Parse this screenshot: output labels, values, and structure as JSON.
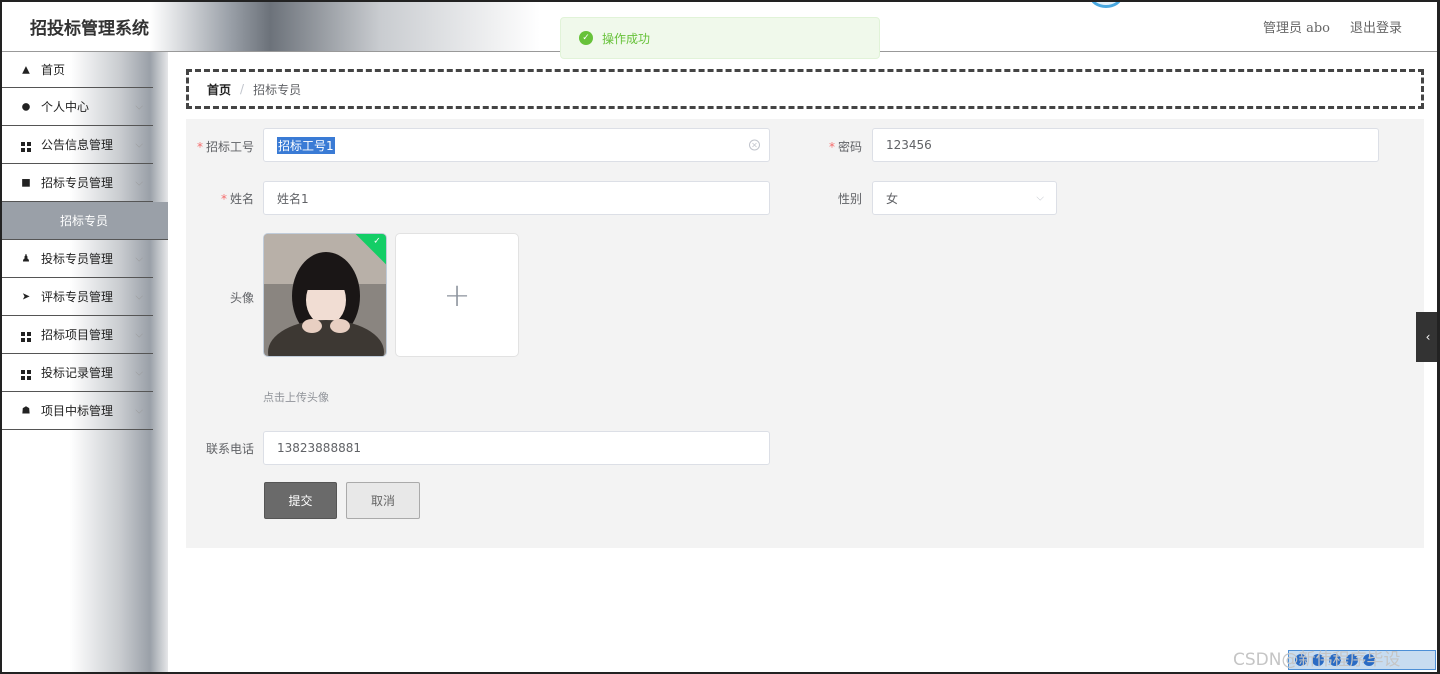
{
  "header": {
    "title": "招投标管理系统",
    "user_label": "管理员 abo",
    "logout_label": "退出登录"
  },
  "toast": {
    "message": "操作成功"
  },
  "sidebar": {
    "items": [
      {
        "label": "首页",
        "icon": "home-icon"
      },
      {
        "label": "个人中心",
        "icon": "user-icon"
      },
      {
        "label": "公告信息管理",
        "icon": "grid-icon"
      },
      {
        "label": "招标专员管理",
        "icon": "briefcase-icon"
      },
      {
        "label": "投标专员管理",
        "icon": "user-tie-icon"
      },
      {
        "label": "评标专员管理",
        "icon": "paper-plane-icon"
      },
      {
        "label": "招标项目管理",
        "icon": "grid-icon"
      },
      {
        "label": "投标记录管理",
        "icon": "grid-icon"
      },
      {
        "label": "项目中标管理",
        "icon": "thumbs-up-icon"
      }
    ],
    "active_sub": "招标专员"
  },
  "breadcrumb": {
    "home": "首页",
    "separator": "/",
    "current": "招标专员"
  },
  "form": {
    "id_label": "招标工号",
    "id_value": "招标工号1",
    "password_label": "密码",
    "password_value": "123456",
    "name_label": "姓名",
    "name_value": "姓名1",
    "gender_label": "性别",
    "gender_value": "女",
    "avatar_label": "头像",
    "avatar_hint": "点击上传头像",
    "phone_label": "联系电话",
    "phone_value": "13823888881",
    "submit_label": "提交",
    "cancel_label": "取消"
  },
  "watermark": "CSDN@新伟程序毕设",
  "colors": {
    "success": "#67c23a",
    "required": "#f56c6c",
    "primary_button": "#6a6a6a"
  }
}
